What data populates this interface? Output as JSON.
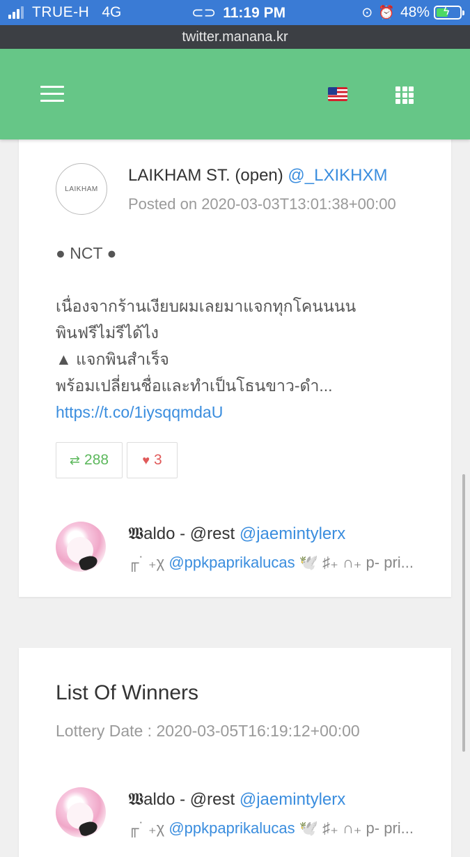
{
  "status_bar": {
    "carrier": "TRUE-H",
    "network": "4G",
    "time": "11:19 PM",
    "battery": "48%"
  },
  "browser": {
    "url": "twitter.manana.kr"
  },
  "header": {
    "menu_icon": "hamburger-menu-icon",
    "language_icon": "us-flag-icon",
    "apps_icon": "grid-apps-icon",
    "background_color": "#66c687"
  },
  "post": {
    "avatar_text": "LAIKHAM",
    "author_name": "LAIKHAM ST. (open)",
    "author_handle": "@_LXIKHXM",
    "posted_on": "Posted on 2020-03-03T13:01:38+00:00",
    "lines": [
      "● NCT ●",
      "",
      "เนื่องจากร้านเงียบผมเลยมาแจกทุกโคนนนน",
      "พินฟรีไม่รีได้ไง",
      "▲ แจกพินสำเร็จ",
      "พร้อมเปลี่ยนชื่อและทำเป็นโธนขาว-ดำ..."
    ],
    "link": "https://t.co/1iysqqmdaU",
    "retweets": "288",
    "likes": "3"
  },
  "comments": [
    {
      "name": "𝖂aldo - @rest",
      "handle": "@jaemintylerx",
      "bio_prefix": "╓˙ ₊χ",
      "bio_mention": "@ppkpaprikalucas",
      "bio_suffix": "🕊️ ♯₊ ∩₊ p- pri..."
    },
    {
      "name": "𝖂aldo - @rest",
      "handle": "@jaemintylerx",
      "bio_prefix": "╓˙ ₊χ",
      "bio_mention": "@ppkpaprikalucas",
      "bio_suffix": "🕊️ ♯₊ ∩₊ p- pri..."
    }
  ],
  "winners": {
    "title": "List Of Winners",
    "lottery_date": "Lottery Date : 2020-03-05T16:19:12+00:00"
  }
}
